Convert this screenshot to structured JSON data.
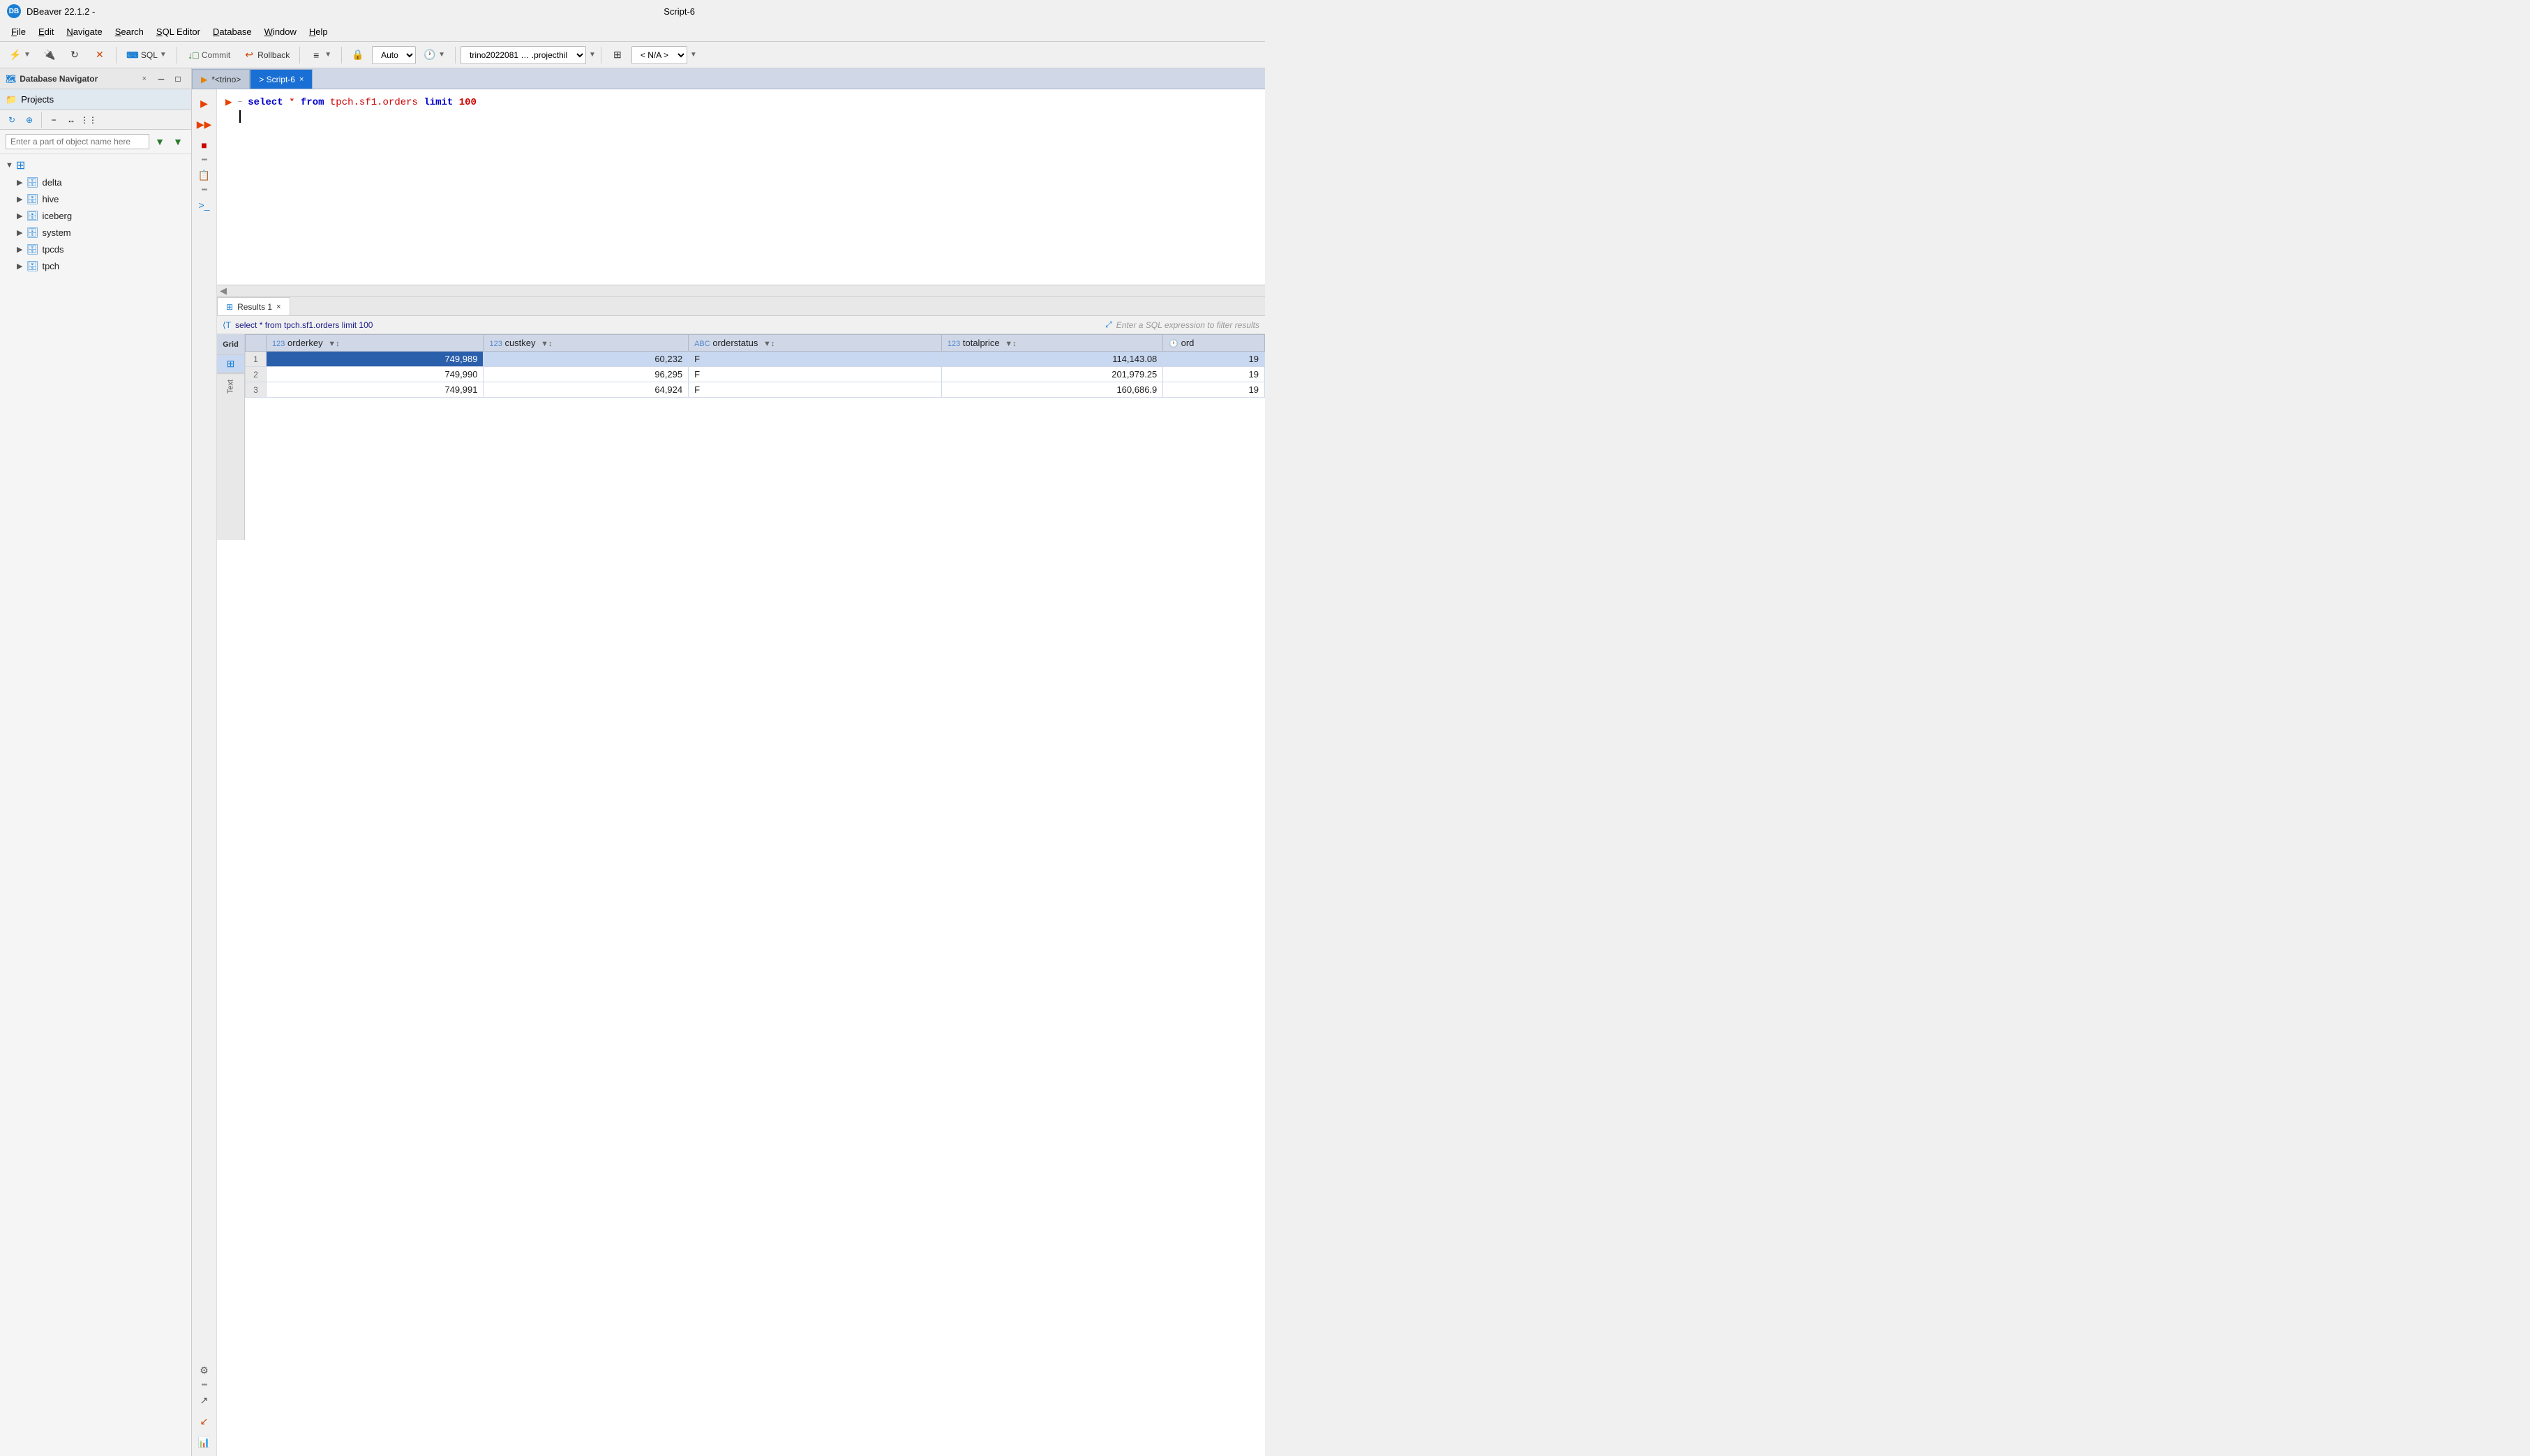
{
  "titleBar": {
    "appName": "DBeaver 22.1.2 -",
    "scriptName": "Script-6",
    "appIconText": "DB"
  },
  "menuBar": {
    "items": [
      "File",
      "Edit",
      "Navigate",
      "Search",
      "SQL Editor",
      "Database",
      "Window",
      "Help"
    ],
    "underlineChars": [
      "F",
      "E",
      "N",
      "S",
      "S",
      "D",
      "W",
      "H"
    ]
  },
  "toolbar": {
    "sqlLabel": "SQL",
    "commitLabel": "Commit",
    "rollbackLabel": "Rollback",
    "autoLabel": "Auto",
    "connectionLabel": "trino2022081 … .projecthil",
    "naLabel": "< N/A >"
  },
  "leftPanel": {
    "title": "Database Navigator",
    "projectsTab": "Projects",
    "searchPlaceholder": "Enter a part of object name here",
    "treeItems": [
      {
        "name": "delta",
        "level": 1
      },
      {
        "name": "hive",
        "level": 1
      },
      {
        "name": "iceberg",
        "level": 1
      },
      {
        "name": "system",
        "level": 1
      },
      {
        "name": "tpcds",
        "level": 1
      },
      {
        "name": "tpch",
        "level": 1
      }
    ]
  },
  "editorTabs": [
    {
      "id": "trino",
      "label": "*<trino>",
      "active": false
    },
    {
      "id": "script6",
      "label": "> Script-6",
      "active": true,
      "closable": true
    }
  ],
  "codeEditor": {
    "query": "select * from tpch.sf1.orders limit 100",
    "keyword1": "select",
    "all": "*",
    "from": "from",
    "table": "tpch.sf1.orders",
    "limit": "limit",
    "limitVal": "100"
  },
  "resultsPanel": {
    "tabLabel": "Results 1",
    "filterQuery": "select * from tpch.sf1.orders limit 100",
    "filterPlaceholder": "Enter a SQL expression to filter results",
    "columns": [
      {
        "type": "123",
        "name": "orderkey",
        "hasFilter": true
      },
      {
        "type": "123",
        "name": "custkey",
        "hasFilter": true
      },
      {
        "type": "ABC",
        "name": "orderstatus",
        "hasFilter": true
      },
      {
        "type": "123",
        "name": "totalprice",
        "hasFilter": true
      },
      {
        "type": "clock",
        "name": "ord",
        "hasFilter": false
      }
    ],
    "rows": [
      {
        "num": 1,
        "orderkey": "749,989",
        "custkey": "60,232",
        "orderstatus": "F",
        "totalprice": "114,143.08",
        "ord": "19",
        "selected": true
      },
      {
        "num": 2,
        "orderkey": "749,990",
        "custkey": "96,295",
        "orderstatus": "F",
        "totalprice": "201,979.25",
        "ord": "19",
        "selected": false
      },
      {
        "num": 3,
        "orderkey": "749,991",
        "custkey": "64,924",
        "orderstatus": "F",
        "totalprice": "160,686.9",
        "ord": "19",
        "selected": false
      }
    ]
  },
  "icons": {
    "refresh": "↻",
    "connect": "⚡",
    "disconnect": "✕",
    "back": "←",
    "forward": "→",
    "new": "⊕",
    "filter": "▼",
    "collapse": "−",
    "expand": "▶",
    "database": "🗄",
    "run": "▶",
    "commit": "↓",
    "rollback": "↩",
    "settings": "⚙",
    "export": "↗",
    "import": "↙",
    "script": "📄",
    "grid": "⊞",
    "chart": "📊",
    "minimize": "─",
    "maximize": "□",
    "close": "×",
    "chevronDown": "▼",
    "chevronRight": "▶",
    "lock": "🔒",
    "clock": "🕐",
    "terminal": ">_"
  }
}
